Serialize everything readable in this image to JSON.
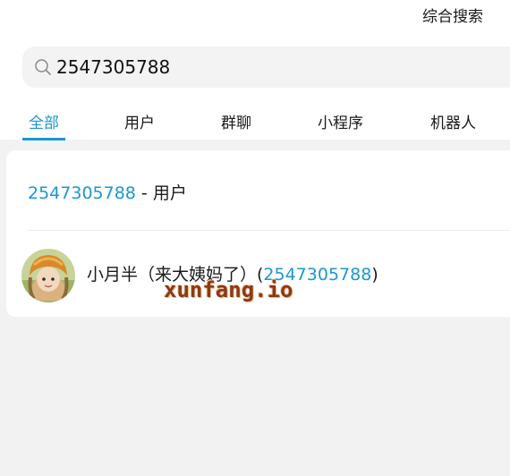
{
  "header": {
    "comprehensive_search": "综合搜索"
  },
  "search": {
    "value": "2547305788"
  },
  "tabs": [
    {
      "label": "全部",
      "active": true
    },
    {
      "label": "用户",
      "active": false
    },
    {
      "label": "群聊",
      "active": false
    },
    {
      "label": "小程序",
      "active": false
    },
    {
      "label": "机器人",
      "active": false
    }
  ],
  "results": {
    "summary_number": "2547305788",
    "summary_suffix": " - 用户",
    "user": {
      "name": "小月半（来大姨妈了）(",
      "number": "2547305788",
      "close": ")",
      "avatar_icon": "user-avatar"
    }
  },
  "watermark": "xunfang.io",
  "colors": {
    "accent": "#1c96d2",
    "background": "#f2f2f2"
  }
}
